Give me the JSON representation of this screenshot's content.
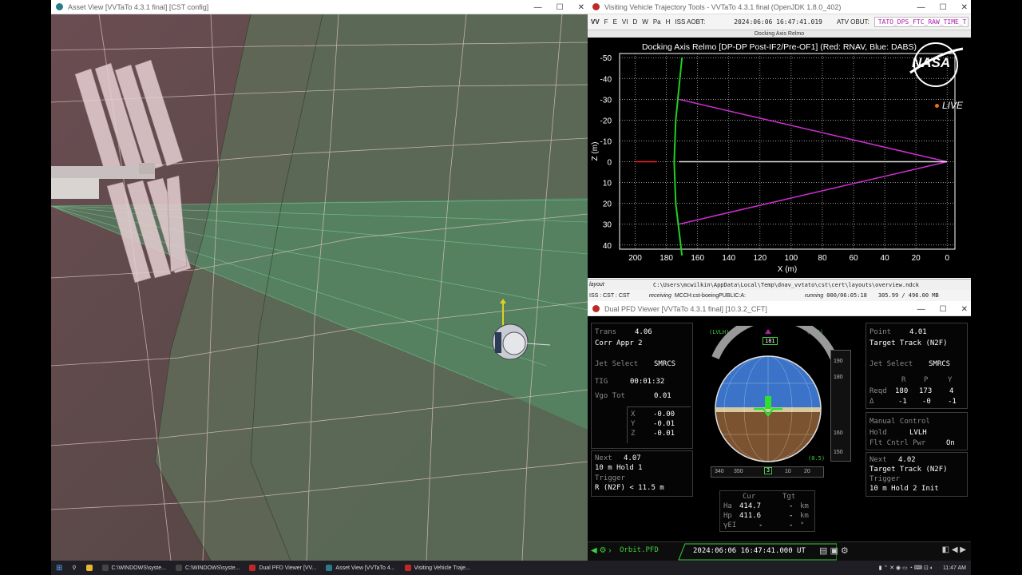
{
  "asset_view": {
    "title": "Asset View [VVTaTo 4.3.1 final] [CST config]"
  },
  "vvtt": {
    "title": "Visiting Vehicle Trajectory Tools - VVTaTo 4.3.1 final (OpenJDK 1.8.0_402)",
    "menu": [
      "VV",
      "F",
      "E",
      "VI",
      "D",
      "W",
      "Pa",
      "H"
    ],
    "aobt_label": "ISS AOBT:",
    "aobt_value": "2024:06:06 16:47:41.019",
    "obut_label": "ATV OBUT:",
    "obut_value": "TATO_DPS_FTC_RAW_TIME_T...",
    "panel_title": "Docking Axis Relmo",
    "path_label": "layout",
    "path_value": "C:\\Users\\mcwilkin\\AppData\\Local\\Temp\\dnav_vvtato\\cst\\cert\\layouts\\overview.ndck",
    "status_left": "ISS : CST : CST",
    "status_recv": "receiving",
    "status_mcch": "MCCH:cst-boeingPUBLIC:A:",
    "status_running": "running",
    "status_time": "000/06:05:18",
    "status_mem": "305.99 / 496.00 MB",
    "live": "LIVE",
    "nasa": "NASA"
  },
  "chart_data": {
    "type": "line",
    "title": "Docking Axis Relmo [DP-DP Post-IF2/Pre-OF1] (Red: RNAV, Blue: DABS)",
    "xlabel": "X (m)",
    "ylabel": "Z (m)",
    "xlim": [
      210,
      -5
    ],
    "ylim": [
      -52,
      42
    ],
    "xticks": [
      200,
      180,
      160,
      140,
      120,
      100,
      80,
      60,
      40,
      20,
      0
    ],
    "yticks": [
      -50,
      -40,
      -30,
      -20,
      -10,
      0,
      10,
      20,
      30,
      40
    ],
    "grid": true,
    "series": [
      {
        "color": "#d030d0",
        "x": [
          172,
          0,
          172
        ],
        "y": [
          -30,
          0,
          30
        ]
      },
      {
        "color": "#20d020",
        "x": [
          170,
          174,
          175,
          174,
          170
        ],
        "y": [
          -50,
          -20,
          0,
          20,
          45
        ]
      },
      {
        "color": "#e0e0e0",
        "x": [
          172,
          0
        ],
        "y": [
          0,
          0
        ]
      },
      {
        "color": "#ff2020",
        "x": [
          200,
          186
        ],
        "y": [
          0,
          0
        ]
      }
    ]
  },
  "pfd": {
    "title": "Dual PFD Viewer [VVTaTo 4.3.1 final] [10.3.2_CFT]",
    "left_top": [
      {
        "k": "Trans",
        "v": "4.06"
      },
      {
        "k": "",
        "v": "Corr Appr 2"
      },
      {
        "k": "Jet Select",
        "v": "SMRCS"
      },
      {
        "k": "TIG",
        "v": "00:01:32"
      },
      {
        "k": "Vgo Tot",
        "v": "0.01"
      }
    ],
    "vgo": [
      {
        "k": "X",
        "v": "-0.00"
      },
      {
        "k": "Y",
        "v": "-0.01"
      },
      {
        "k": "Z",
        "v": "-0.01"
      }
    ],
    "left_next": {
      "label": "Next",
      "id": "4.07",
      "name": "10 m Hold 1",
      "trig_label": "Trigger",
      "trig": "R (N2F) < 11.5 m"
    },
    "right_top": {
      "point_label": "Point",
      "point": "4.01",
      "mode": "Target Track (N2F)",
      "jet_label": "Jet Select",
      "jet": "SMRCS",
      "rpy": [
        "R",
        "P",
        "Y"
      ],
      "reqd_label": "Reqd",
      "reqd": [
        "180",
        "173",
        "4"
      ],
      "delta_label": "Δ",
      "delta": [
        "-1",
        "-0",
        "-1"
      ]
    },
    "manual": {
      "title": "Manual Control",
      "hold_label": "Hold",
      "hold": "LVLH",
      "fcp_label": "Flt Cntrl Pwr",
      "fcp": "On"
    },
    "right_next": {
      "label": "Next",
      "id": "4.02",
      "name": "Target Track (N2F)",
      "trig_label": "Trigger",
      "trig": "10 m Hold 2 Init"
    },
    "adi": {
      "lvlh": "(LVLH)",
      "pyr": "(PYR)",
      "roll_value": "181",
      "roll_ticks": [
        "160",
        "170",
        "190",
        "200"
      ],
      "pitch_value": "173",
      "pitch_ticks": [
        "190",
        "180",
        "160",
        "150"
      ],
      "yaw_value": "3",
      "yaw_ticks": [
        "340",
        "350",
        "10",
        "20"
      ],
      "rate": "(0.5)"
    },
    "orbit": {
      "cur": "Cur",
      "tgt": "Tgt",
      "rows": [
        {
          "k": "Ha",
          "cur": "414.7",
          "tgt": "-",
          "u": "km"
        },
        {
          "k": "Hp",
          "cur": "411.6",
          "tgt": "-",
          "u": "km"
        },
        {
          "k": "γEI",
          "cur": "-",
          "tgt": "-",
          "u": "°"
        }
      ]
    },
    "footer_nav": "Orbit.PFD",
    "footer_time": "2024:06:06 16:47:41.000 UT"
  },
  "taskbar": {
    "items": [
      "C:\\WINDOWS\\syste...",
      "C:\\WINDOWS\\syste...",
      "Dual PFD Viewer [VV...",
      "Asset View [VVTaTo 4...",
      "Visiting Vehicle Traje..."
    ],
    "clock": "11:47 AM"
  }
}
